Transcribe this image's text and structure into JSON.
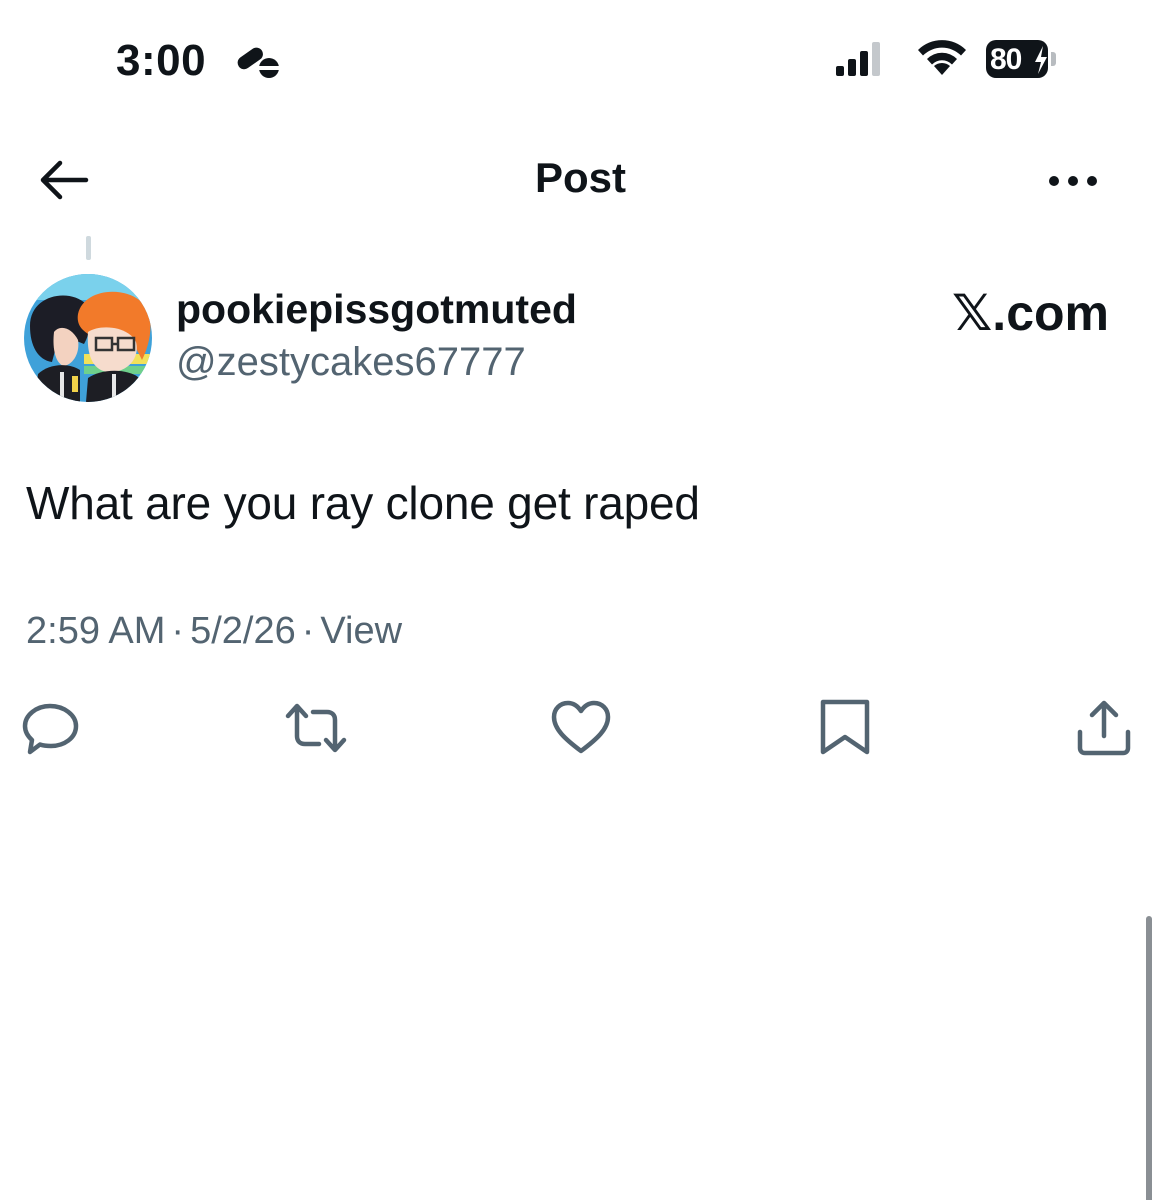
{
  "status_bar": {
    "time": "3:00",
    "battery_level": "80",
    "battery_charging": true
  },
  "header": {
    "title": "Post"
  },
  "post": {
    "author": {
      "display_name": "pookiepissgotmuted",
      "handle": "@zestycakes67777"
    },
    "source_label": "𝕏.com",
    "text": "What are you ray clone get raped",
    "meta": {
      "time": "2:59 AM",
      "separator": "·",
      "date": "5/2/26",
      "view_label": "View"
    },
    "actions": [
      "reply",
      "repost",
      "like",
      "bookmark",
      "share"
    ]
  },
  "colors": {
    "text_primary": "#0f1419",
    "text_secondary": "#536471",
    "icon_gray": "#536471",
    "thread_line": "#cfd9de",
    "background": "#ffffff"
  }
}
